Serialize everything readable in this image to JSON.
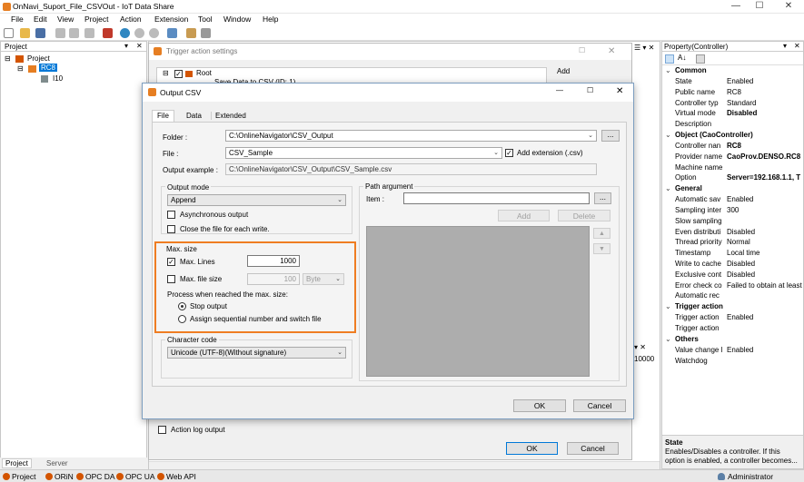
{
  "app": {
    "title": "OnNavi_Suport_File_CSVOut - IoT Data Share"
  },
  "menu": [
    "File",
    "Edit",
    "View",
    "Project",
    "Action",
    "Extension",
    "Tool",
    "Window",
    "Help"
  ],
  "project_panel": {
    "title": "Project",
    "tree": {
      "root": "Project",
      "controller": "RC8",
      "child": "I10"
    },
    "tabs": {
      "project": "Project",
      "server": "Server"
    }
  },
  "trigger_dialog": {
    "title": "Trigger action settings",
    "tree_root": "Root",
    "tree_child": "Save Data to CSV (ID: 1)",
    "add_label": "Add",
    "action_log_output": "Action log output",
    "ok": "OK",
    "cancel": "Cancel"
  },
  "output_csv": {
    "title": "Output CSV",
    "tabs": {
      "file": "File",
      "data": "Data",
      "extended": "Extended"
    },
    "folder_label": "Folder :",
    "folder_value": "C:\\OnlineNavigator\\CSV_Output",
    "browse": "...",
    "file_label": "File :",
    "file_value": "CSV_Sample",
    "add_extension": "Add extension (.csv)",
    "example_label": "Output example :",
    "example_value": "C:\\OnlineNavigator\\CSV_Output\\CSV_Sample.csv",
    "output_mode": {
      "title": "Output mode",
      "value": "Append",
      "async": "Asynchronous output",
      "close_each": "Close the file for each write."
    },
    "max_size": {
      "title": "Max. size",
      "max_lines_label": "Max. Lines",
      "max_lines_value": "1000",
      "max_file_label": "Max. file size",
      "max_file_value": "100",
      "unit": "Byte",
      "process_label": "Process when reached the max. size:",
      "stop_output": "Stop output",
      "assign_seq": "Assign sequential number and switch file"
    },
    "charset": {
      "title": "Character code",
      "value": "Unicode (UTF-8)(Without signature)"
    },
    "path_argument": {
      "title": "Path argument",
      "item_label": "Item :",
      "add": "Add",
      "delete": "Delete"
    },
    "ok": "OK",
    "cancel": "Cancel"
  },
  "property_panel": {
    "title": "Property(Controller)",
    "categories": [
      {
        "name": "Common",
        "rows": [
          [
            "State",
            "Enabled",
            false
          ],
          [
            "Public name",
            "RC8",
            false
          ],
          [
            "Controller typ",
            "Standard",
            false
          ],
          [
            "Virtual mode",
            "Disabled",
            true
          ],
          [
            "Description",
            "",
            false
          ]
        ]
      },
      {
        "name": "Object (CaoController)",
        "rows": [
          [
            "Controller nan",
            "RC8",
            true
          ],
          [
            "Provider name",
            "CaoProv.DENSO.RC8",
            true
          ],
          [
            "Machine name",
            "",
            false
          ],
          [
            "Option",
            "Server=192.168.1.1, T",
            true
          ]
        ]
      },
      {
        "name": "General",
        "rows": [
          [
            "Automatic sav",
            "Enabled",
            false
          ],
          [
            "Sampling inter",
            "300",
            false
          ],
          [
            "Slow sampling",
            "",
            false
          ],
          [
            "Even distributi",
            "Disabled",
            false
          ],
          [
            "Thread priority",
            "Normal",
            false
          ],
          [
            "Timestamp",
            "Local time",
            false
          ],
          [
            "Write to cache",
            "Disabled",
            false
          ],
          [
            "Exclusive cont",
            "Disabled",
            false
          ],
          [
            "Error check co",
            "Failed to obtain at least",
            false
          ],
          [
            "Automatic rec",
            "",
            false
          ]
        ]
      },
      {
        "name": "Trigger action",
        "rows": [
          [
            "Trigger action",
            "Enabled",
            false
          ],
          [
            "Trigger action",
            "",
            false
          ]
        ]
      },
      {
        "name": "Others",
        "rows": [
          [
            "Value change l",
            "Enabled",
            false
          ],
          [
            "Watchdog",
            "",
            false
          ]
        ]
      }
    ],
    "desc_title": "State",
    "desc_text": "Enables/Disables a controller. If this option is enabled, a controller becomes..."
  },
  "mid_panel": {
    "value": "10000"
  },
  "statusbar": {
    "items": [
      "Project",
      "ORiN",
      "OPC DA",
      "OPC UA",
      "Web API"
    ],
    "user": "Administrator"
  },
  "colors": {
    "highlight": "#ef7d22",
    "selection": "#0078d7"
  }
}
